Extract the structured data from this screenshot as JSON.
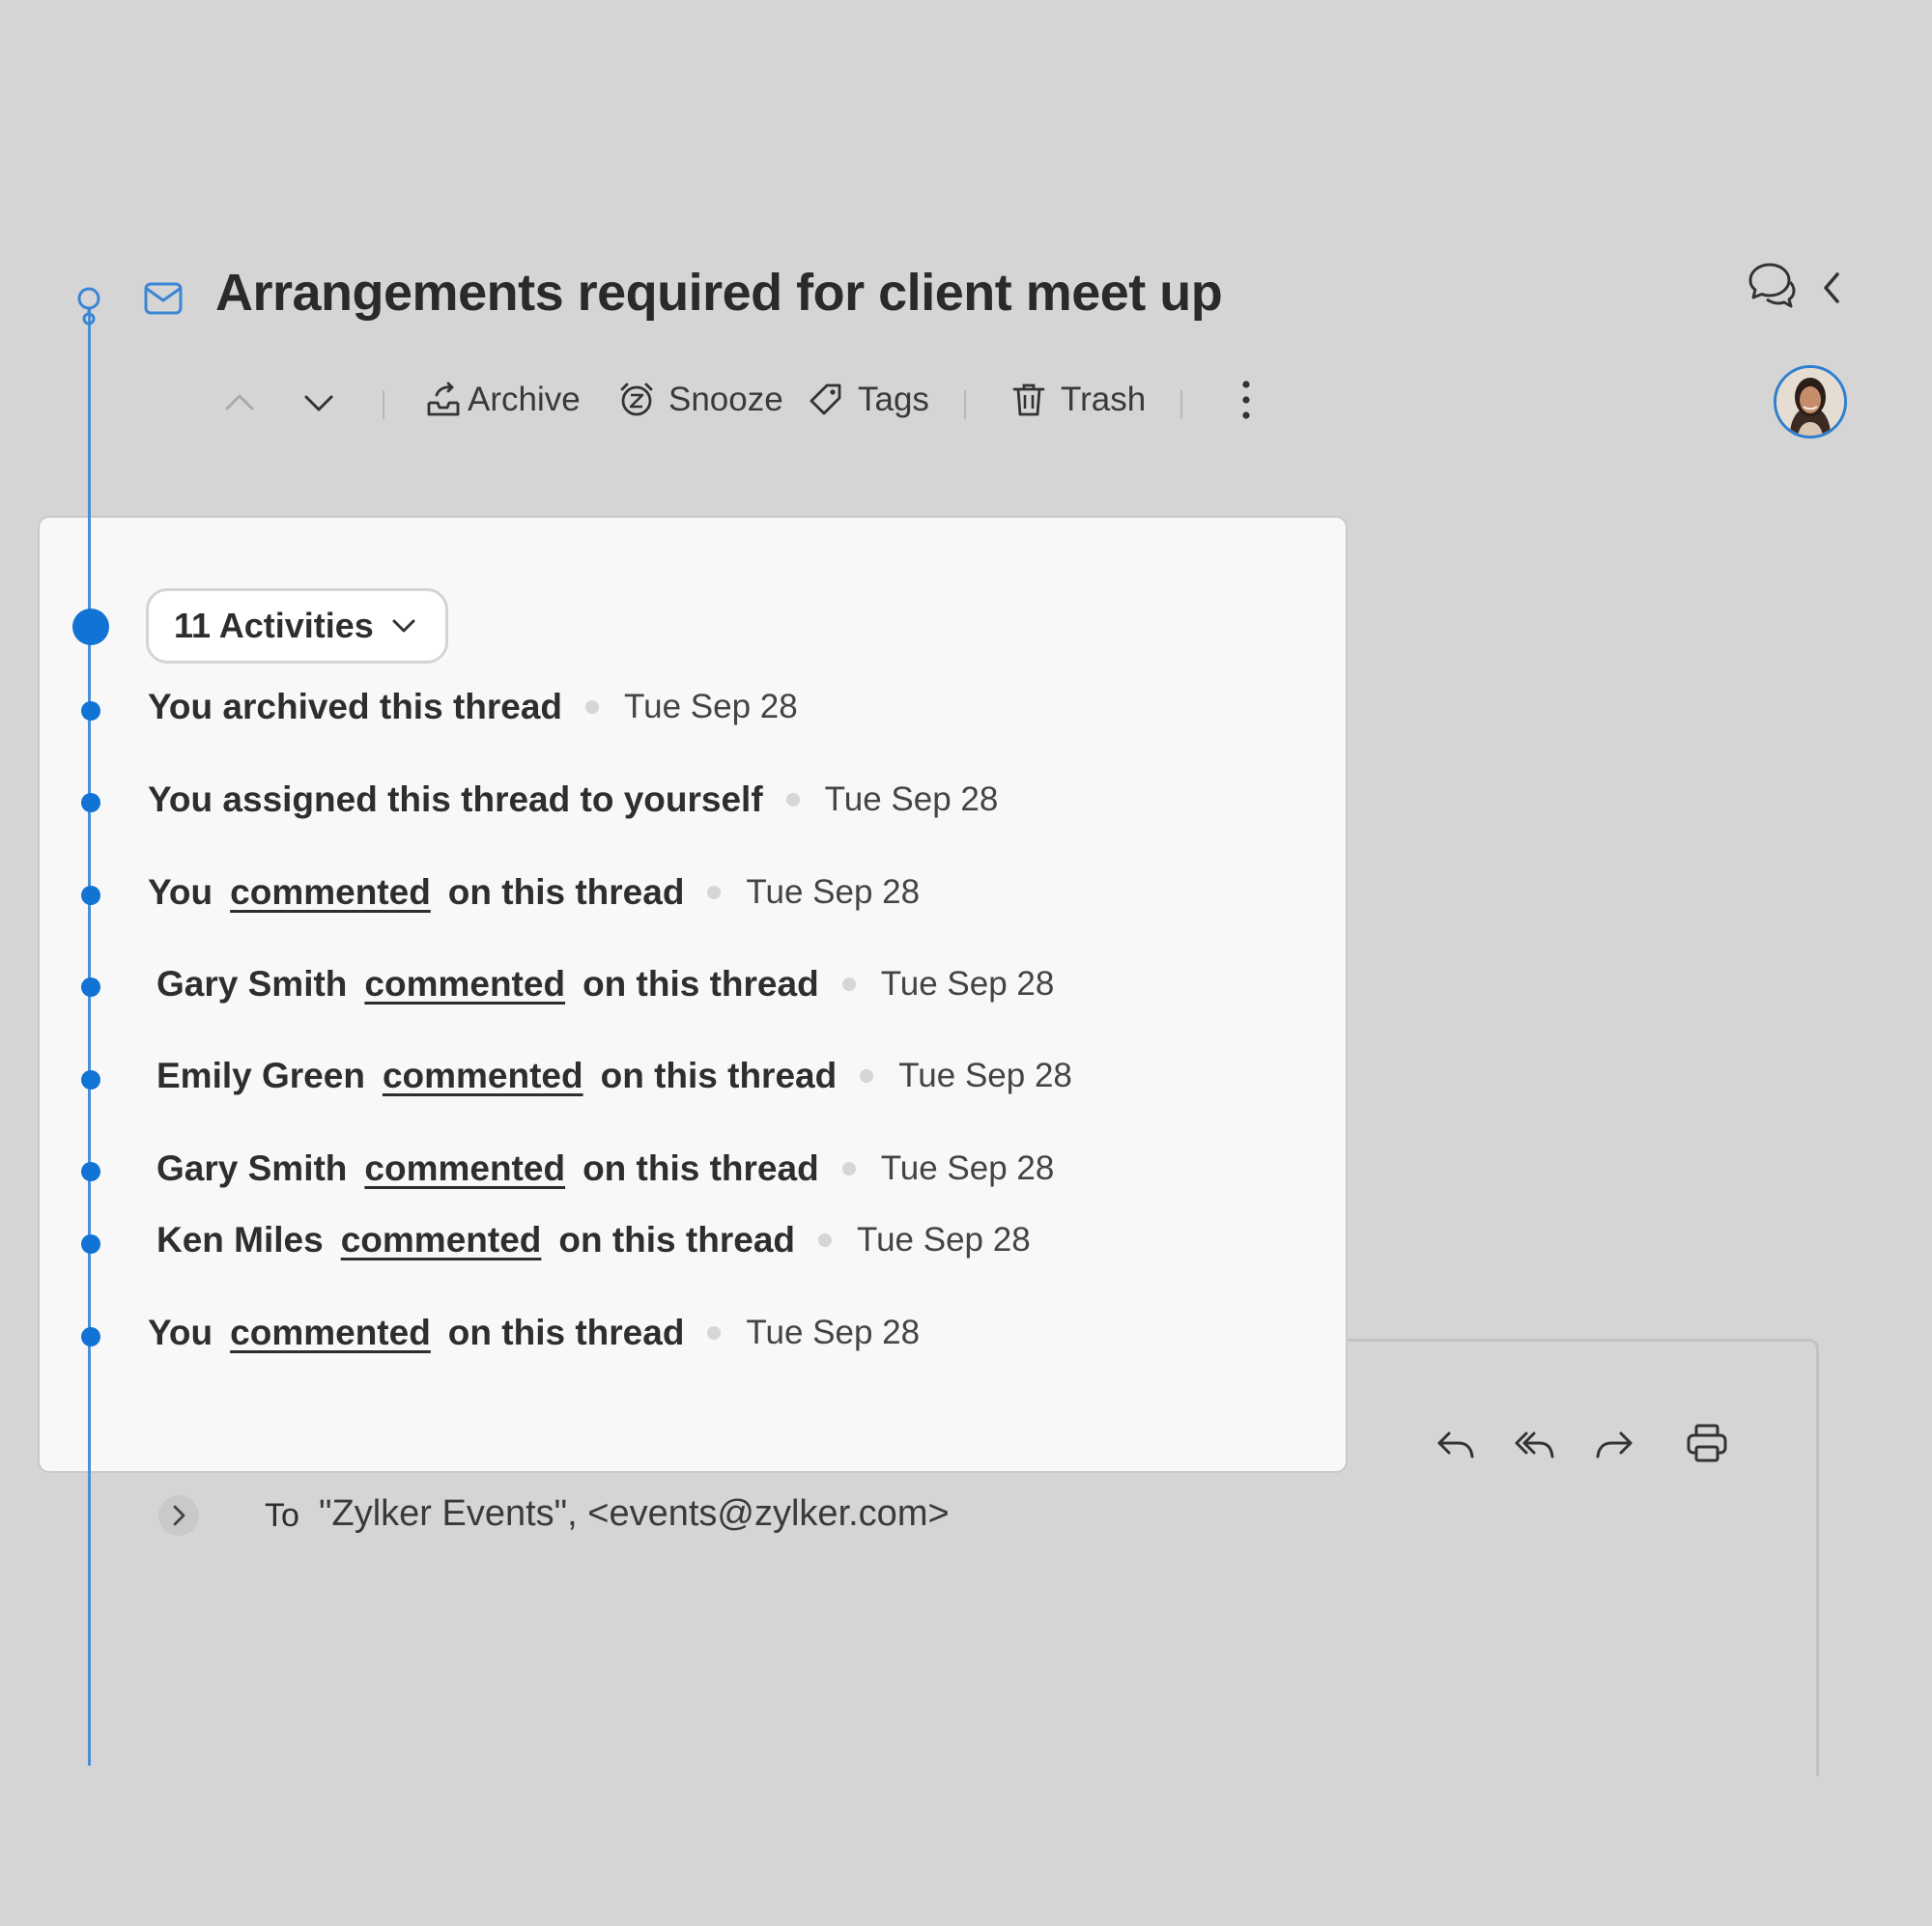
{
  "header": {
    "title": "Arrangements required for client meet up"
  },
  "toolbar": {
    "archive_label": "Archive",
    "snooze_label": "Snooze",
    "tags_label": "Tags",
    "trash_label": "Trash"
  },
  "activities": {
    "count_label": "11 Activities",
    "items": [
      {
        "actor": "You archived this thread",
        "verb": "",
        "suffix": "",
        "date": "Tue Sep 28"
      },
      {
        "actor": "You assigned this thread to yourself",
        "verb": "",
        "suffix": "",
        "date": "Tue Sep 28"
      },
      {
        "actor": "You",
        "verb": "commented",
        "suffix": "on this thread",
        "date": "Tue Sep 28"
      },
      {
        "actor": "Gary Smith",
        "verb": "commented",
        "suffix": "on this thread",
        "date": "Tue Sep 28"
      },
      {
        "actor": "Emily Green",
        "verb": "commented",
        "suffix": "on this thread",
        "date": "Tue Sep 28"
      },
      {
        "actor": "Gary Smith",
        "verb": "commented",
        "suffix": "on this thread",
        "date": "Tue Sep 28"
      },
      {
        "actor": "Ken Miles",
        "verb": "commented",
        "suffix": "on this thread",
        "date": "Tue Sep 28"
      },
      {
        "actor": "You",
        "verb": "commented",
        "suffix": "on this thread",
        "date": "Tue Sep 28"
      }
    ]
  },
  "email": {
    "to_label": "To",
    "to_value": "\"Zylker Events\", <events@zylker.com>"
  },
  "icons": {
    "mail": "mail-icon",
    "chat": "chat-bubbles-icon",
    "collapse": "chevron-left-icon",
    "prev": "chevron-up-icon",
    "next": "chevron-down-icon",
    "archive": "archive-tray-icon",
    "snooze": "snooze-clock-icon",
    "tags": "tag-icon",
    "trash": "trash-icon",
    "more": "more-vertical-icon",
    "reply": "reply-icon",
    "reply_all": "reply-all-icon",
    "forward": "forward-icon",
    "print": "print-icon"
  },
  "colors": {
    "background": "#d5d5d5",
    "accent": "#1173d4",
    "timeline": "#4a90d9",
    "panel": "#f8f8f8"
  }
}
